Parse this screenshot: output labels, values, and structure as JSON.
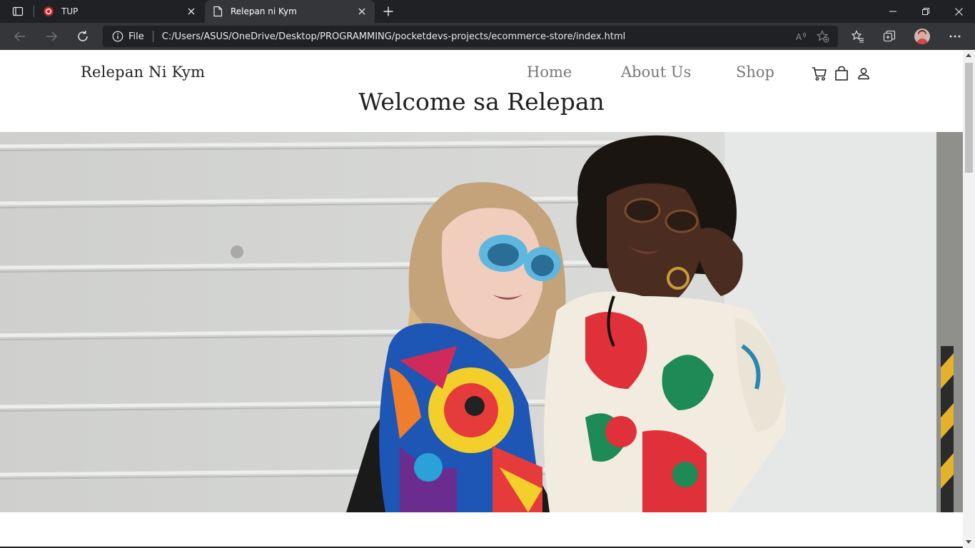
{
  "browser": {
    "tabs": [
      {
        "title": "TUP",
        "active": false
      },
      {
        "title": "Relepan ni Kym",
        "active": true
      }
    ],
    "address": {
      "scheme_label": "File",
      "url": "C:/Users/ASUS/OneDrive/Desktop/PROGRAMMING/pocketdevs-projects/ecommerce-store/index.html"
    }
  },
  "site": {
    "brand": "Relepan Ni Kym",
    "nav": [
      "Home",
      "About Us",
      "Shop"
    ],
    "welcome": "Welcome sa Relepan",
    "icons": [
      "cart-icon",
      "shopping-bag-icon",
      "user-icon"
    ]
  },
  "colors": {
    "tabbar": "#202124",
    "toolbar": "#35363a",
    "nav_text": "#777777",
    "heading_text": "#1f1f1f"
  }
}
